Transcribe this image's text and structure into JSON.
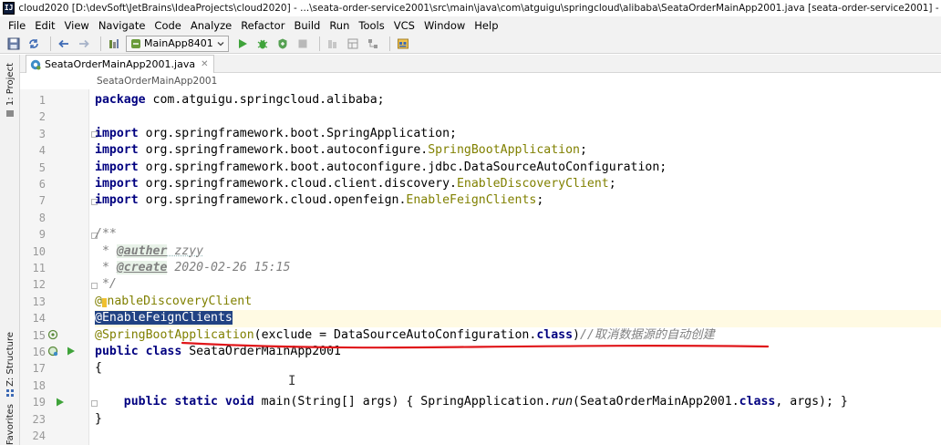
{
  "window": {
    "title": "cloud2020 [D:\\devSoft\\JetBrains\\IdeaProjects\\cloud2020] - ...\\seata-order-service2001\\src\\main\\java\\com\\atguigu\\springcloud\\alibaba\\SeataOrderMainApp2001.java [seata-order-service2001] - IntelliJ IDEA",
    "app_icon": "IJ"
  },
  "menu": [
    "File",
    "Edit",
    "View",
    "Navigate",
    "Code",
    "Analyze",
    "Refactor",
    "Build",
    "Run",
    "Tools",
    "VCS",
    "Window",
    "Help"
  ],
  "toolbar": {
    "run_config": "MainApp8401",
    "icons": [
      "save-all-icon",
      "sync-icon",
      "back-icon",
      "forward-icon",
      "build-icon",
      "run-icon",
      "debug-icon",
      "coverage-icon",
      "stop-icon",
      "project-structure-icon"
    ]
  },
  "side_tabs": {
    "project": "1: Project",
    "structure": "Z: Structure",
    "favorites": "Favorites"
  },
  "editor": {
    "tab_label": "SeataOrderMainApp2001.java",
    "breadcrumb": "SeataOrderMainApp2001",
    "line_numbers": [
      "1",
      "2",
      "3",
      "4",
      "5",
      "6",
      "7",
      "8",
      "9",
      "10",
      "11",
      "12",
      "13",
      "14",
      "15",
      "16",
      "17",
      "18",
      "19",
      "23",
      "24"
    ],
    "lines": {
      "l1_kw": "package",
      "l1_rest": " com.atguigu.springcloud.alibaba;",
      "import_kw": "import",
      "l3_rest": " org.springframework.boot.SpringApplication;",
      "l4_pre": " org.springframework.boot.autoconfigure.",
      "l4_ann": "SpringBootApplication",
      "l4_end": ";",
      "l5_rest": " org.springframework.boot.autoconfigure.jdbc.DataSourceAutoConfiguration;",
      "l6_pre": " org.springframework.cloud.client.discovery.",
      "l6_ann": "EnableDiscoveryClient",
      "l6_end": ";",
      "l7_pre": " org.springframework.cloud.openfeign.",
      "l7_ann": "EnableFeignClients",
      "l7_end": ";",
      "l9": "/**",
      "l10_star": " * ",
      "l10_tag": "@auther",
      "l10_val": " zzyy",
      "l11_star": " * ",
      "l11_tag": "@create",
      "l11_val": " 2020-02-26 15:15",
      "l12": " */",
      "l13_a": "@",
      "l13_b": "nableDiscoveryClient",
      "l14": "@EnableFeignClients",
      "l15_ann": "@SpringBootApplication",
      "l15_args": "(exclude = DataSourceAutoConfiguration.",
      "l15_class": "class",
      "l15_close": ")",
      "l15_comment": "//取消数据源的自动创建",
      "l16_kw": "public class",
      "l16_rest": " SeataOrderMainApp2001",
      "l17": "{",
      "l19_pre": "    ",
      "l19_kw": "public static void",
      "l19_mid": " main(String[] args) { SpringApplication.",
      "l19_run": "run",
      "l19_args": "(SeataOrderMainApp2001.",
      "l19_class": "class",
      "l19_end": ", args); }",
      "l23": "}"
    }
  },
  "colors": {
    "keyword": "#000080",
    "annotation": "#808000",
    "comment": "#808080",
    "selection": "#214283",
    "red_annotation_stroke": "#e0161a"
  }
}
